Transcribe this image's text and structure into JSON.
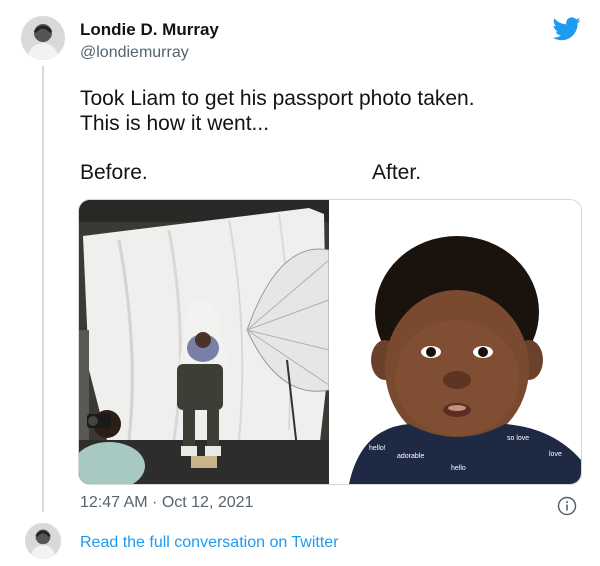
{
  "author": {
    "name": "Londie D. Murray",
    "handle": "@londiemurray"
  },
  "tweet": {
    "line1": "Took Liam to get his passport photo taken.",
    "line2": "This is how it went...",
    "caption_before": "Before.",
    "caption_after": "After."
  },
  "media": {
    "before_photo": "studio-photoshoot-photo",
    "after_photo": "passport-baby-photo",
    "onesie_print": [
      "hello!",
      "adorable",
      "so love",
      "hello",
      "love"
    ]
  },
  "timestamp": "12:47 AM · Oct 12, 2021",
  "footer": {
    "link_text": "Read the full conversation on Twitter"
  },
  "icons": {
    "brand": "twitter-bird-icon",
    "info": "info-icon"
  },
  "colors": {
    "twitter_blue": "#1d9bf0",
    "secondary_text": "#536471",
    "thread_line": "#cfd9de"
  }
}
